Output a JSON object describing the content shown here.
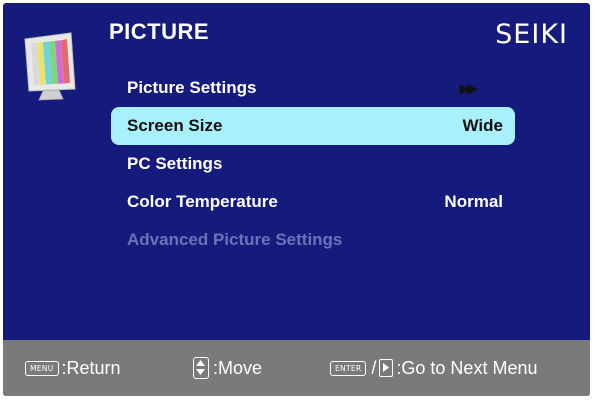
{
  "header": {
    "title": "PICTURE",
    "brand": "SEIKI",
    "icon": "monitor-color-bars-icon"
  },
  "menu": {
    "items": [
      {
        "label": "Picture Settings",
        "value": "",
        "state": "normal",
        "indicator": "double-arrow-right-icon"
      },
      {
        "label": "Screen Size",
        "value": "Wide",
        "state": "selected"
      },
      {
        "label": "PC Settings",
        "value": "",
        "state": "normal"
      },
      {
        "label": "Color Temperature",
        "value": "Normal",
        "state": "normal"
      },
      {
        "label": "Advanced Picture Settings",
        "value": "",
        "state": "disabled"
      }
    ]
  },
  "footer": {
    "menu_key": "MENU",
    "menu_action": ":Return",
    "move_action": ":Move",
    "enter_key": "ENTER",
    "slash": "/",
    "next_action": ":Go to Next Menu"
  },
  "colors": {
    "background": "#151b7c",
    "selected": "#a8f0fb",
    "disabled_text": "#6d71b7",
    "footer": "#7a7a7a"
  }
}
